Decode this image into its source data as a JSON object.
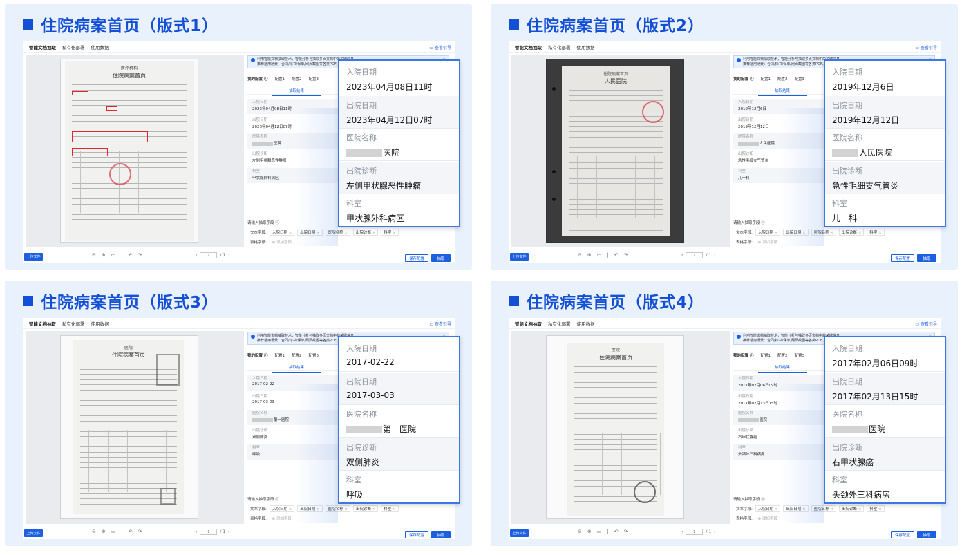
{
  "panels": [
    {
      "title": "住院病案首页（版式1）",
      "tabs": [
        "智能文档抽取",
        "私有化部署",
        "使用数据"
      ],
      "guide": "查看引导",
      "notice_line1": "利用智能文档抽取技术，智能分析与抽取多页文档中的关键信息",
      "notice_line2": "推荐适用场景：合同/标书/保单/网页截图等各类PDF、Word等",
      "my_config": "我的配置",
      "configs": [
        "配置1",
        "配置2",
        "配置3"
      ],
      "result_tab": "抽取结果",
      "doc": {
        "hospital_title": "住院病案首页",
        "header_top": "医疗机构"
      },
      "fields": [
        {
          "label": "入院日期",
          "value": "2023年04月08日11时"
        },
        {
          "label": "出院日期",
          "value": "2023年04月12日07时"
        },
        {
          "label": "医院名称",
          "value": "医院"
        },
        {
          "label": "出院诊断",
          "value": "左侧甲状腺恶性肿瘤"
        },
        {
          "label": "科室",
          "value": "甲状腺外科病区"
        }
      ],
      "input_label": "请输入抽取字段",
      "text_fields_label": "文本字段:",
      "chips": [
        "入院日期",
        "出院日期",
        "医院名称",
        "出院诊断",
        "科室"
      ],
      "table_fields_label": "表格字段:",
      "add_field": "添加字段",
      "upload": "上传文件",
      "page_current": "1",
      "page_total": "/ 1",
      "save": "保存配置",
      "extract": "抽取"
    },
    {
      "title": "住院病案首页（版式2）",
      "tabs": [
        "智能文档抽取",
        "私有化部署",
        "使用数据"
      ],
      "guide": "查看引导",
      "notice_line1": "利用智能文档抽取技术，智能分析与抽取多页文档中的关键信息",
      "notice_line2": "推荐适用场景：合同/标书/保单/网页截图等各类PDF、Word等",
      "my_config": "我的配置",
      "configs": [
        "配置1",
        "配置2",
        "配置3"
      ],
      "result_tab": "抽取结果",
      "doc": {
        "hospital_title": "人民医院",
        "header_top": "住院病案首页"
      },
      "fields": [
        {
          "label": "入院日期",
          "value": "2019年12月6日"
        },
        {
          "label": "出院日期",
          "value": "2019年12月12日"
        },
        {
          "label": "医院名称",
          "value": "人民医院"
        },
        {
          "label": "出院诊断",
          "value": "急性毛细支气管炎"
        },
        {
          "label": "科室",
          "value": "儿一科"
        }
      ],
      "input_label": "请输入抽取字段",
      "text_fields_label": "文本字段:",
      "chips": [
        "入院日期",
        "出院日期",
        "医院名称",
        "出院诊断",
        "科室"
      ],
      "table_fields_label": "表格字段:",
      "add_field": "添加字段",
      "upload": "上传文件",
      "page_current": "1",
      "page_total": "/ 1",
      "save": "保存配置",
      "extract": "抽取"
    },
    {
      "title": "住院病案首页（版式3）",
      "tabs": [
        "智能文档抽取",
        "私有化部署",
        "使用数据"
      ],
      "guide": "查看引导",
      "notice_line1": "利用智能文档抽取技术，智能分析与抽取多页文档中的关键信息",
      "notice_line2": "推荐适用场景：合同/标书/保单/网页截图等各类PDF、Word等",
      "my_config": "我的配置",
      "configs": [
        "配置1",
        "配置2",
        "配置3"
      ],
      "result_tab": "抽取结果",
      "doc": {
        "hospital_title": "住院病案首页",
        "header_top": "医院"
      },
      "fields": [
        {
          "label": "入院日期",
          "value": "2017-02-22"
        },
        {
          "label": "出院日期",
          "value": "2017-03-03"
        },
        {
          "label": "医院名称",
          "value": "第一医院"
        },
        {
          "label": "出院诊断",
          "value": "双侧肺炎"
        },
        {
          "label": "科室",
          "value": "呼吸"
        }
      ],
      "input_label": "请输入抽取字段",
      "text_fields_label": "文本字段:",
      "chips": [
        "入院日期",
        "出院日期",
        "医院名称",
        "出院诊断",
        "科室"
      ],
      "table_fields_label": "表格字段:",
      "add_field": "添加字段",
      "upload": "上传文件",
      "page_current": "1",
      "page_total": "/ 1",
      "save": "保存配置",
      "extract": "抽取"
    },
    {
      "title": "住院病案首页（版式4）",
      "tabs": [
        "智能文档抽取",
        "私有化部署",
        "使用数据"
      ],
      "guide": "查看引导",
      "notice_line1": "利用智能文档抽取技术，智能分析与抽取多页文档中的关键信息",
      "notice_line2": "推荐适用场景：合同/标书/保单/网页截图等各类PDF、Word等",
      "my_config": "我的配置",
      "configs": [
        "配置1",
        "配置2",
        "配置3"
      ],
      "result_tab": "抽取结果",
      "doc": {
        "hospital_title": "住院病案首页",
        "header_top": "医院"
      },
      "fields": [
        {
          "label": "入院日期",
          "value": "2017年02月06日09时"
        },
        {
          "label": "出院日期",
          "value": "2017年02月13日15时"
        },
        {
          "label": "医院名称",
          "value": "医院"
        },
        {
          "label": "出院诊断",
          "value": "右甲状腺癌"
        },
        {
          "label": "科室",
          "value": "头颈外三科病房"
        }
      ],
      "input_label": "请输入抽取字段",
      "text_fields_label": "文本字段:",
      "chips": [
        "入院日期",
        "出院日期",
        "医院名称",
        "出院诊断",
        "科室"
      ],
      "table_fields_label": "表格字段:",
      "add_field": "添加字段",
      "upload": "上传文件",
      "page_current": "1",
      "page_total": "/ 1",
      "save": "保存配置",
      "extract": "抽取"
    }
  ],
  "colors": {
    "accent": "#1c5fe0",
    "title": "#1450d6",
    "panel_bg": "#e9f1fd",
    "stamp": "#d9404a"
  },
  "icons": [
    "book-icon",
    "info-icon",
    "close-icon",
    "help-icon",
    "zoom-out-icon",
    "zoom-in-icon",
    "fit-icon",
    "rotate-left-icon",
    "rotate-right-icon",
    "chevron-left-icon",
    "chevron-right-icon",
    "plus-circle-icon"
  ]
}
